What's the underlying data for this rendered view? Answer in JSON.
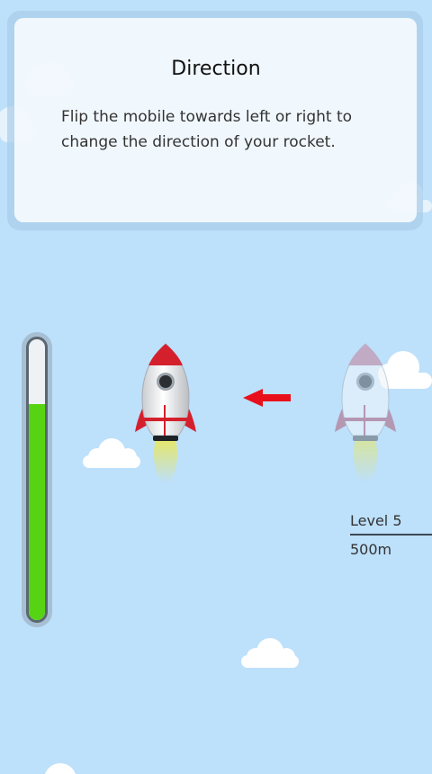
{
  "card": {
    "title": "Direction",
    "text": "Flip the mobile towards left or right to change the direction of your rocket."
  },
  "fuel": {
    "level_fraction": 0.77,
    "color": "#56d414"
  },
  "hud": {
    "level": "Level 5",
    "distance": "500m"
  },
  "colors": {
    "sky": "#bde0fb",
    "rocket_accent": "#d4202c",
    "arrow": "#e8111b"
  },
  "icons": {
    "player_rocket": "rocket-icon",
    "ghost_rocket": "rocket-icon",
    "direction_arrow": "arrow-left-icon"
  }
}
